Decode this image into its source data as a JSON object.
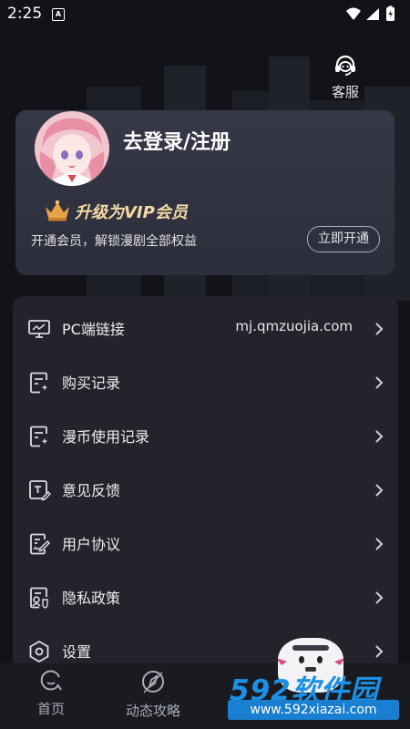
{
  "status_bar": {
    "time": "2:25",
    "indicator": "A",
    "icons": [
      "wifi-icon",
      "signal-icon",
      "battery-icon"
    ]
  },
  "header": {
    "service_label": "客服",
    "service_icon": "headset-icon"
  },
  "profile": {
    "login_label": "去登录/注册",
    "vip_title": "升级为VIP会员",
    "vip_icon": "crown-icon",
    "vip_description": "开通会员，解锁漫剧全部权益",
    "vip_button": "立即开通"
  },
  "menu": {
    "items": [
      {
        "label": "PC端链接",
        "value": "mj.qmzuojia.com",
        "icon": "monitor-icon"
      },
      {
        "label": "购买记录",
        "icon": "purchase-record-icon"
      },
      {
        "label": "漫币使用记录",
        "icon": "coin-record-icon"
      },
      {
        "label": "意见反馈",
        "icon": "feedback-icon"
      },
      {
        "label": "用户协议",
        "icon": "user-agreement-icon"
      },
      {
        "label": "隐私政策",
        "icon": "privacy-policy-icon"
      },
      {
        "label": "设置",
        "icon": "settings-icon"
      }
    ]
  },
  "bottom_nav": {
    "items": [
      {
        "label": "首页",
        "icon": "home-icon"
      },
      {
        "label": "动态攻略",
        "icon": "compass-icon"
      }
    ]
  },
  "watermark": {
    "logo": "592软件园",
    "url": "www.592xiazai.com"
  },
  "colors": {
    "background": "#121318",
    "card": "#363848",
    "panel": "#23242b",
    "vip_gold": "#f4d9a6",
    "watermark_blue": "#1c8fe6"
  }
}
